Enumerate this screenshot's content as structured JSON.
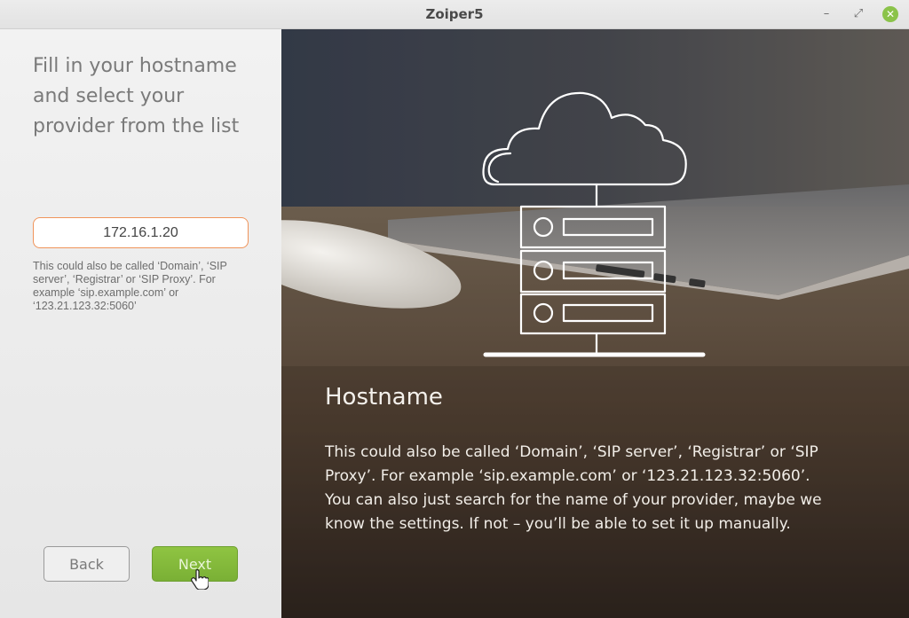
{
  "window": {
    "title": "Zoiper5",
    "controls": {
      "minimize": "–",
      "maximize": "⤢",
      "close": "✕"
    }
  },
  "left": {
    "heading": "Fill in your hostname and select your provider from the list",
    "hostname": {
      "value": "172.16.1.20"
    },
    "hint": "This could also be called ‘Domain’, ‘SIP server’, ‘Registrar’ or ‘SIP Proxy’. For example ‘sip.example.com’ or ‘123.21.123.32:5060’",
    "buttons": {
      "back": "Back",
      "next": "Next"
    }
  },
  "right": {
    "title": "Hostname",
    "body": "This could also be called ‘Domain’, ‘SIP server’, ‘Registrar’ or ‘SIP Proxy’. For example ‘sip.example.com’ or ‘123.21.123.32:5060’.\nYou can also just search for the name of your provider, maybe we know the settings. If not – you’ll be able to set it up manually."
  },
  "colors": {
    "accent_green": "#7ab035",
    "input_border": "#f0945a",
    "close_button": "#8bc34a"
  }
}
